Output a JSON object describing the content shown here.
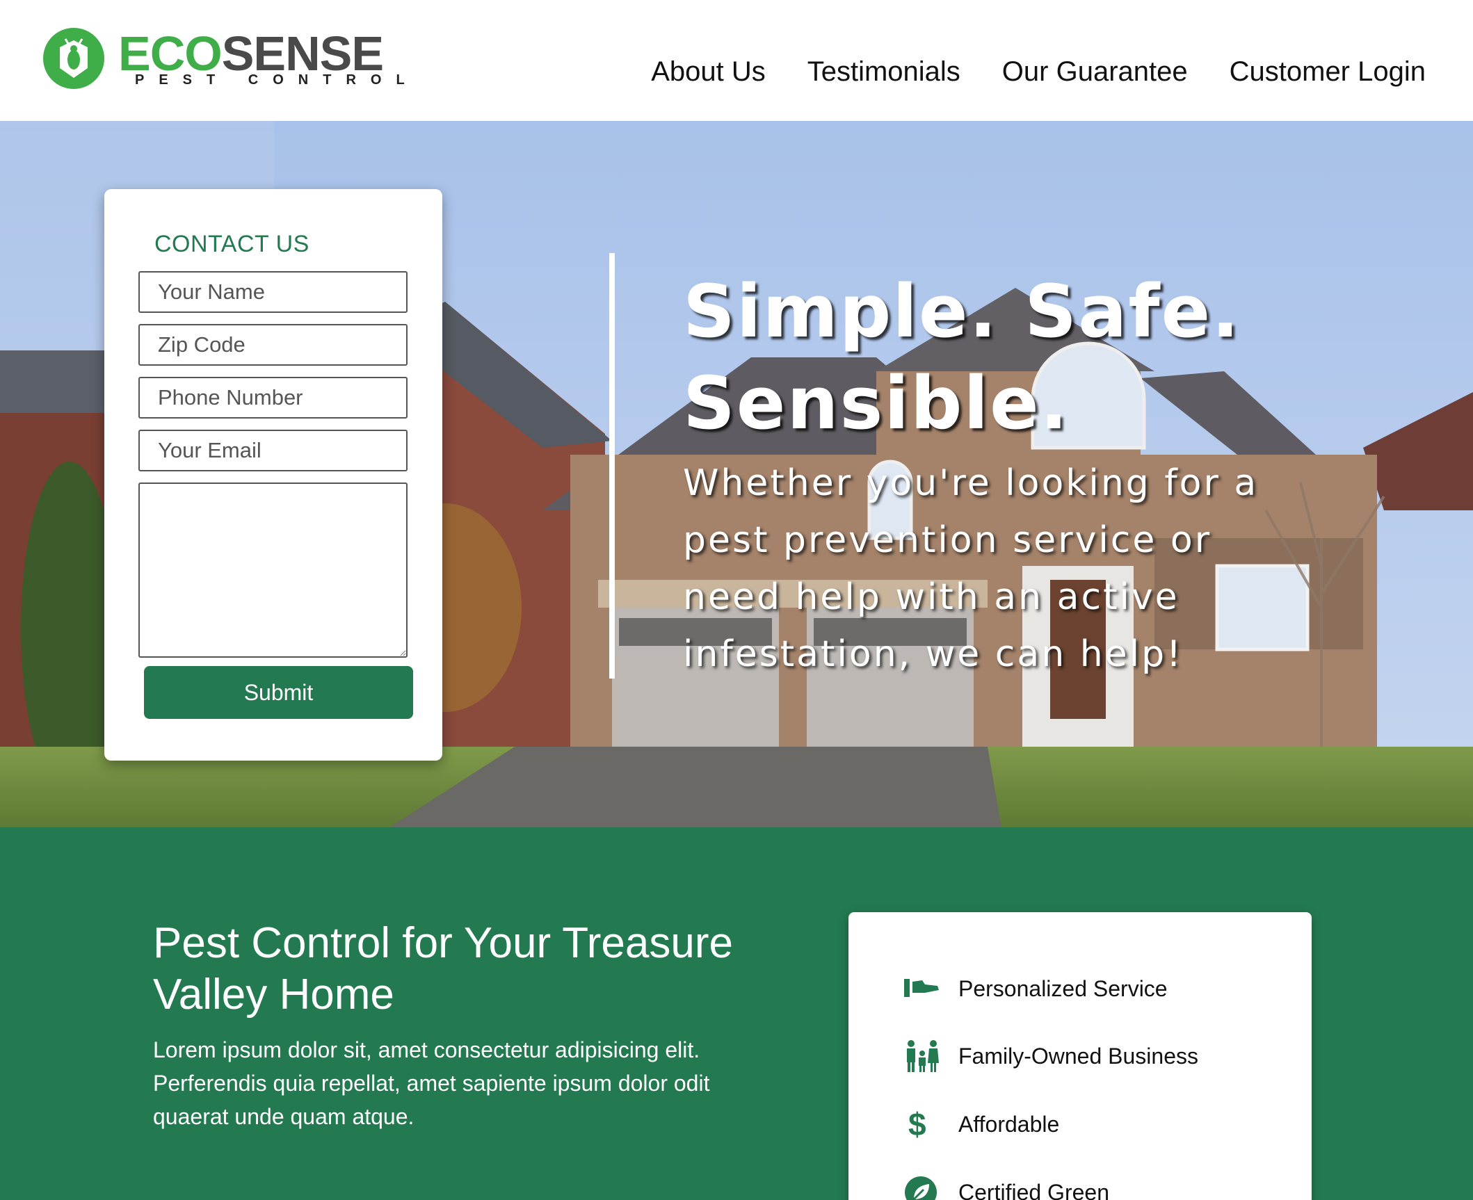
{
  "brand": {
    "name_part1": "ECO",
    "name_part2": "SENSE",
    "tagline": "PEST CONTROL",
    "green": "#3fae49",
    "gray": "#4a4a4a"
  },
  "nav": {
    "items": [
      {
        "label": "About Us"
      },
      {
        "label": "Testimonials"
      },
      {
        "label": "Our Guarantee"
      },
      {
        "label": "Customer Login"
      }
    ]
  },
  "contact": {
    "title": "CONTACT US",
    "name_placeholder": "Your Name",
    "zip_placeholder": "Zip Code",
    "phone_placeholder": "Phone Number",
    "email_placeholder": "Your Email",
    "message_value": "",
    "submit_label": "Submit"
  },
  "hero": {
    "title": "Simple. Safe. Sensible.",
    "subtitle": "Whether you're looking for a pest prevention service or need help with an active infestation, we can help!"
  },
  "intro": {
    "title": "Pest Control for Your Treasure Valley Home",
    "body": "Lorem ipsum dolor sit, amet consectetur adipisicing elit. Perferendis quia repellat, amet sapiente ipsum dolor odit quaerat unde quam atque."
  },
  "features": [
    {
      "icon": "hand-icon",
      "label": "Personalized Service"
    },
    {
      "icon": "family-icon",
      "label": "Family-Owned Business"
    },
    {
      "icon": "dollar-icon",
      "label": "Affordable"
    },
    {
      "icon": "leaf-icon",
      "label": "Certified Green"
    }
  ],
  "colors": {
    "accent": "#237a50"
  }
}
